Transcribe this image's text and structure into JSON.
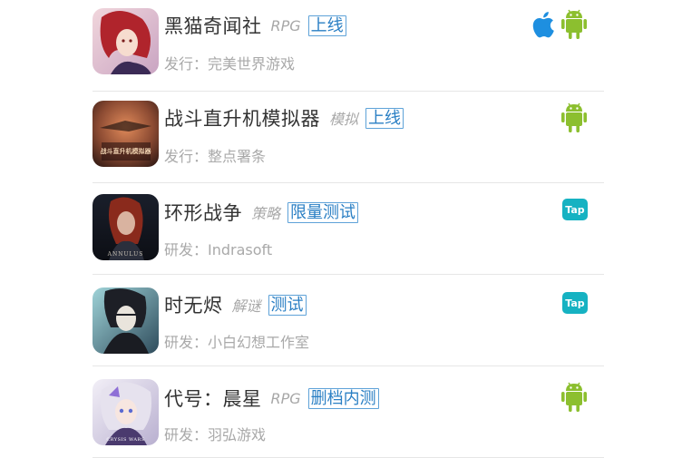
{
  "games": [
    {
      "name": "黑猫奇闻社",
      "genre": "RPG",
      "status": "上线",
      "publisher": "发行：完美世界游戏",
      "cover_caption": "",
      "platforms": [
        "apple-icon",
        "android-icon"
      ]
    },
    {
      "name": "战斗直升机模拟器",
      "genre": "模拟",
      "status": "上线",
      "publisher": "发行：整点署条",
      "cover_caption": "战斗直升机模拟器",
      "platforms": [
        "android-icon"
      ]
    },
    {
      "name": "环形战争",
      "genre": "策略",
      "status": "限量测试",
      "publisher": "研发：Indrasoft",
      "cover_caption": "ANNULUS",
      "platforms": [
        "taptap-icon"
      ]
    },
    {
      "name": "时无烬",
      "genre": "解谜",
      "status": "测试",
      "publisher": "研发：小白幻想工作室",
      "cover_caption": "",
      "platforms": [
        "taptap-icon"
      ]
    },
    {
      "name": "代号：晨星",
      "genre": "RPG",
      "status": "删档内测",
      "publisher": "研发：羽弘游戏",
      "cover_caption": "CRYSIS WARS",
      "platforms": [
        "android-icon"
      ]
    }
  ],
  "taptap_label": "Tap",
  "colors": {
    "apple": "#1e8fe0",
    "android": "#8cbf2f",
    "taptap": "#16b2c2",
    "status_text": "#2a7fc4",
    "status_border": "#5ea2d8"
  }
}
